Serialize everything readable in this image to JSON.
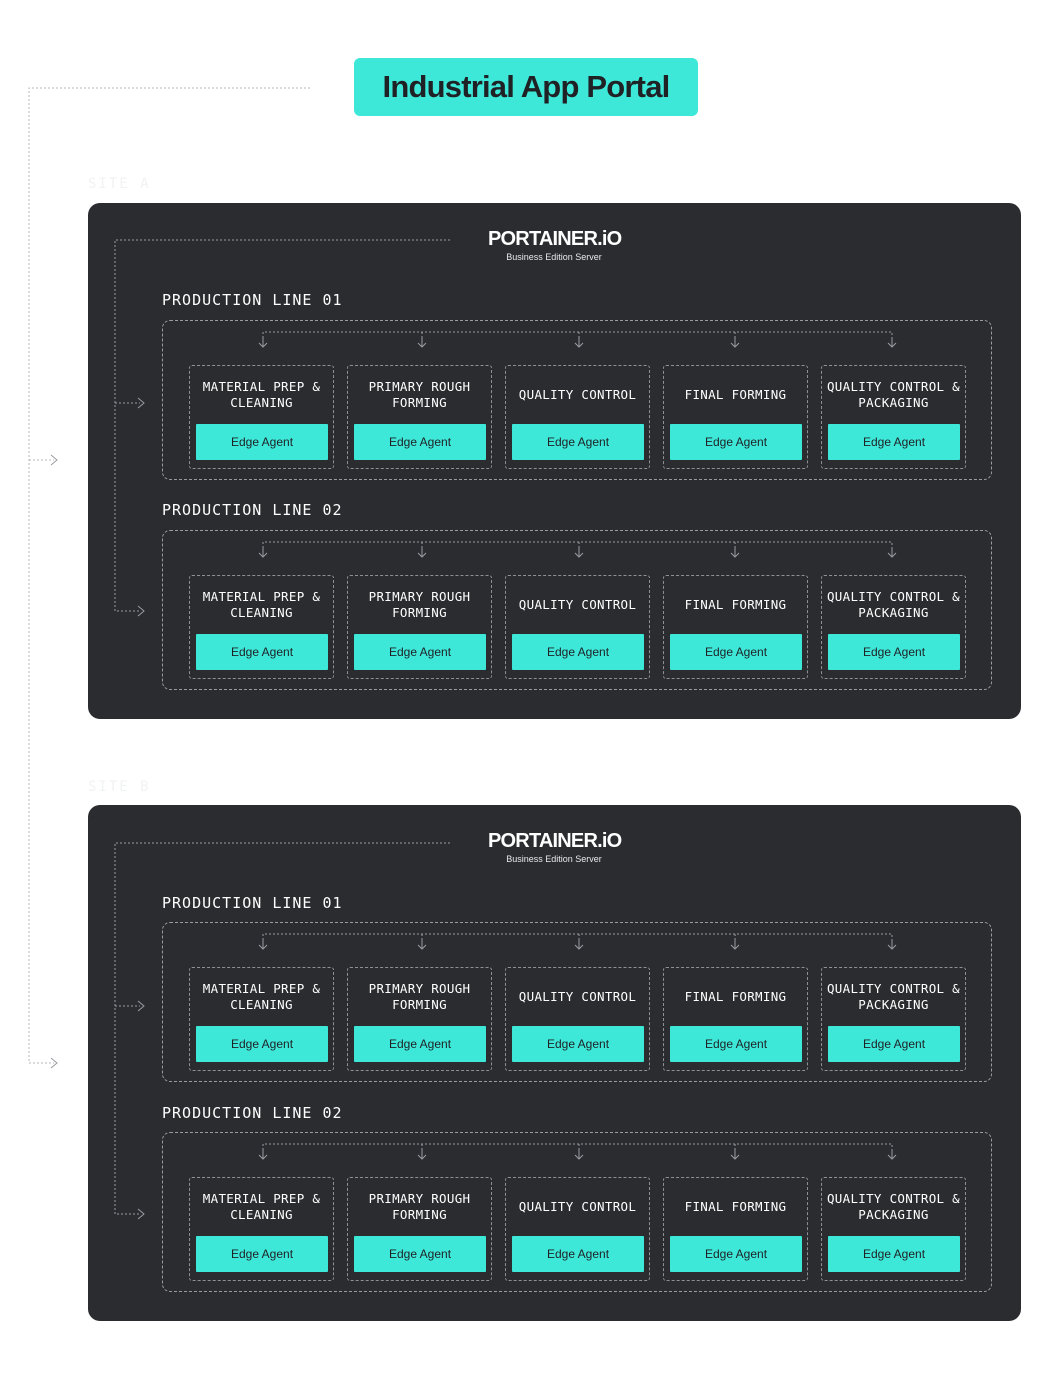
{
  "portal": {
    "title": "Industrial App Portal"
  },
  "colors": {
    "accent": "#3ee8d9",
    "panel": "#2b2c30",
    "background": "#ffffff"
  },
  "sites": [
    {
      "label": "SITE A",
      "server": {
        "logo": "PORTAINER.iO",
        "subtitle": "Business Edition Server"
      },
      "lines": [
        {
          "label": "PRODUCTION LINE 01",
          "stages": [
            {
              "name": "MATERIAL PREP & CLEANING",
              "agent": "Edge Agent"
            },
            {
              "name": "PRIMARY ROUGH FORMING",
              "agent": "Edge Agent"
            },
            {
              "name": "QUALITY CONTROL",
              "agent": "Edge Agent"
            },
            {
              "name": "FINAL FORMING",
              "agent": "Edge Agent"
            },
            {
              "name": "QUALITY CONTROL & PACKAGING",
              "agent": "Edge Agent"
            }
          ]
        },
        {
          "label": "PRODUCTION LINE 02",
          "stages": [
            {
              "name": "MATERIAL PREP & CLEANING",
              "agent": "Edge Agent"
            },
            {
              "name": "PRIMARY ROUGH FORMING",
              "agent": "Edge Agent"
            },
            {
              "name": "QUALITY CONTROL",
              "agent": "Edge Agent"
            },
            {
              "name": "FINAL FORMING",
              "agent": "Edge Agent"
            },
            {
              "name": "QUALITY CONTROL & PACKAGING",
              "agent": "Edge Agent"
            }
          ]
        }
      ]
    },
    {
      "label": "SITE B",
      "server": {
        "logo": "PORTAINER.iO",
        "subtitle": "Business Edition Server"
      },
      "lines": [
        {
          "label": "PRODUCTION LINE 01",
          "stages": [
            {
              "name": "MATERIAL PREP & CLEANING",
              "agent": "Edge Agent"
            },
            {
              "name": "PRIMARY ROUGH FORMING",
              "agent": "Edge Agent"
            },
            {
              "name": "QUALITY CONTROL",
              "agent": "Edge Agent"
            },
            {
              "name": "FINAL FORMING",
              "agent": "Edge Agent"
            },
            {
              "name": "QUALITY CONTROL & PACKAGING",
              "agent": "Edge Agent"
            }
          ]
        },
        {
          "label": "PRODUCTION LINE 02",
          "stages": [
            {
              "name": "MATERIAL PREP & CLEANING",
              "agent": "Edge Agent"
            },
            {
              "name": "PRIMARY ROUGH FORMING",
              "agent": "Edge Agent"
            },
            {
              "name": "QUALITY CONTROL",
              "agent": "Edge Agent"
            },
            {
              "name": "FINAL FORMING",
              "agent": "Edge Agent"
            },
            {
              "name": "QUALITY CONTROL & PACKAGING",
              "agent": "Edge Agent"
            }
          ]
        }
      ]
    }
  ]
}
